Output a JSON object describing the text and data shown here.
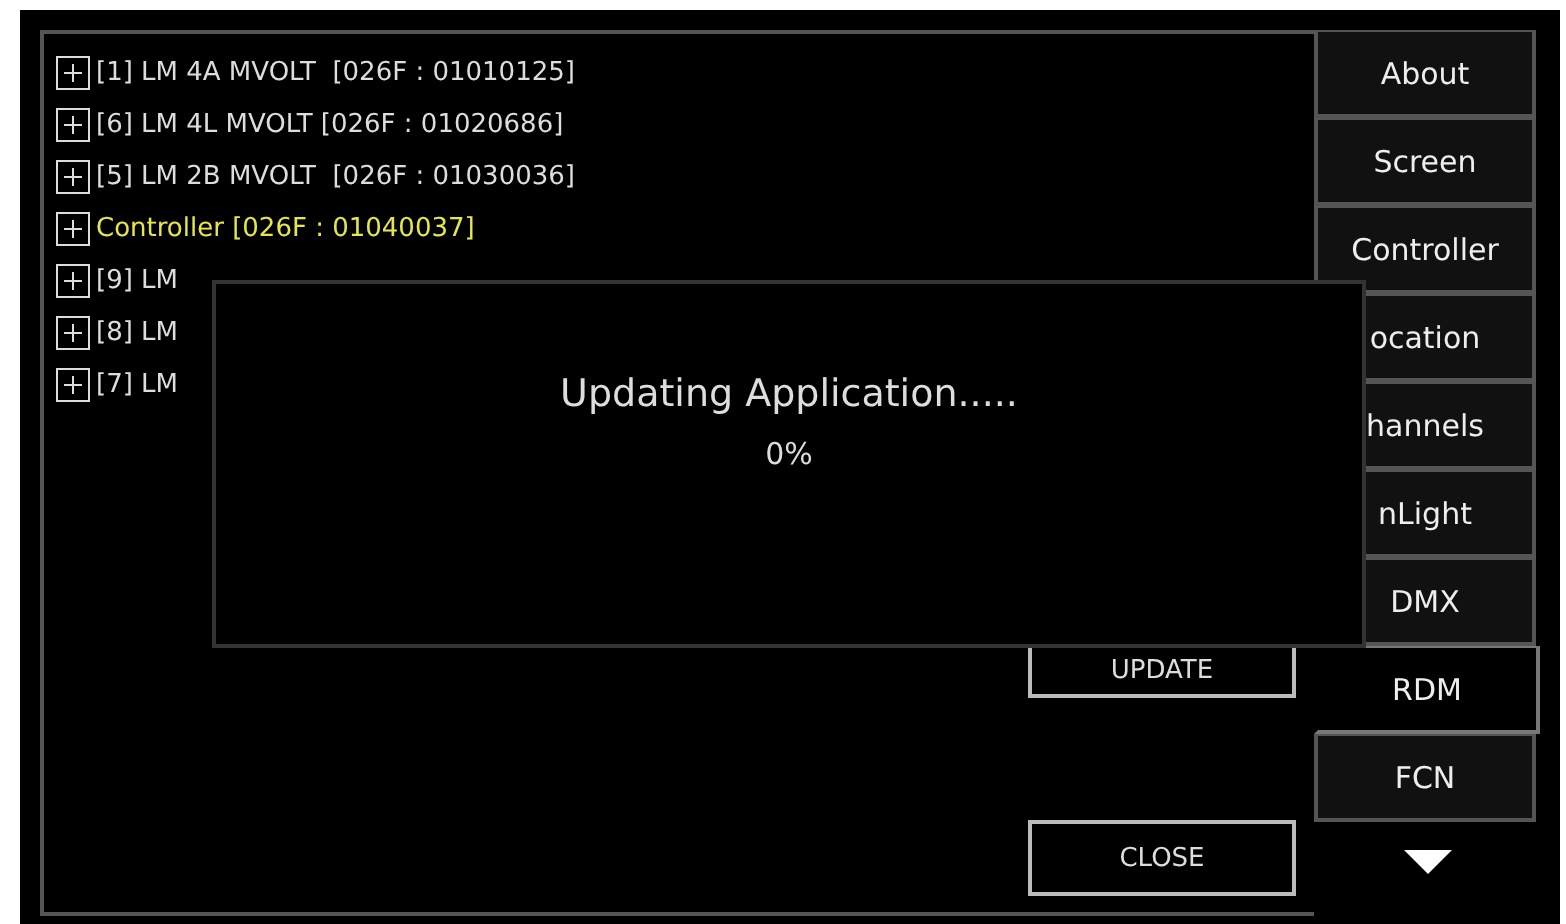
{
  "tree": {
    "items": [
      {
        "label": "[1] LM 4A MVOLT  [026F : 01010125]",
        "selected": false,
        "expanded": false
      },
      {
        "label": "[6] LM 4L MVOLT [026F : 01020686]",
        "selected": false,
        "expanded": false
      },
      {
        "label": "[5] LM 2B MVOLT  [026F : 01030036]",
        "selected": false,
        "expanded": false
      },
      {
        "label": "Controller [026F : 01040037]",
        "selected": true,
        "expanded": false
      },
      {
        "label": "[9] LM",
        "selected": false,
        "expanded": false
      },
      {
        "label": "[8] LM",
        "selected": false,
        "expanded": false
      },
      {
        "label": "[7] LM",
        "selected": false,
        "expanded": false
      }
    ]
  },
  "buttons": [
    {
      "label": "UPDATE",
      "kind": "update"
    },
    {
      "label": "CLOSE",
      "kind": "close"
    }
  ],
  "tabs": [
    {
      "label": "About",
      "selected": false
    },
    {
      "label": "Screen",
      "selected": false
    },
    {
      "label": "Controller",
      "selected": false
    },
    {
      "label": "ocation",
      "selected": false
    },
    {
      "label": "hannels",
      "selected": false
    },
    {
      "label": "nLight",
      "selected": false
    },
    {
      "label": "DMX",
      "selected": false
    },
    {
      "label": "RDM",
      "selected": true
    },
    {
      "label": "FCN",
      "selected": false
    }
  ],
  "dialog": {
    "message": "Updating Application.....",
    "progress": "0%"
  }
}
